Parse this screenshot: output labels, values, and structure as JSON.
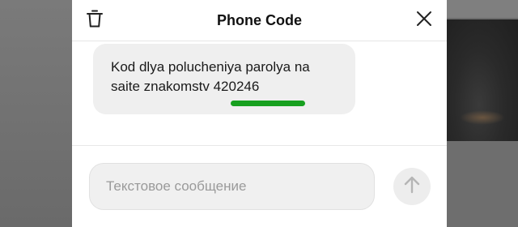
{
  "header": {
    "title": "Phone Code",
    "left_icon": "trash-icon",
    "right_icon": "close-icon"
  },
  "messages": [
    {
      "line1": "Kod dlya polucheniya parolya na",
      "line2": "saite znakomstv 420246",
      "highlight_color": "#17a01f"
    }
  ],
  "composer": {
    "placeholder": "Текстовое сообщение",
    "send_icon": "arrow-up-icon"
  },
  "colors": {
    "accent_green": "#17a01f",
    "bubble_bg": "#efefef"
  }
}
